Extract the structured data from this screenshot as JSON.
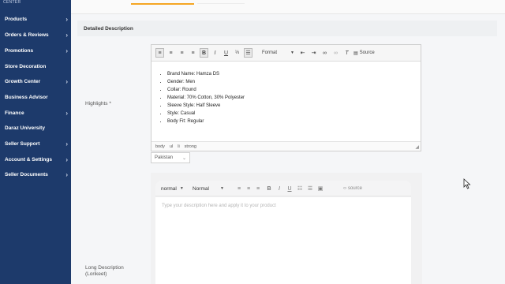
{
  "sidebar": {
    "brand": "CENTER",
    "items": [
      {
        "label": "Products",
        "chevron": true
      },
      {
        "label": "Orders & Reviews",
        "chevron": true
      },
      {
        "label": "Promotions",
        "chevron": true
      },
      {
        "label": "Store Decoration",
        "chevron": false
      },
      {
        "label": "Growth Center",
        "chevron": true
      },
      {
        "label": "Business Advisor",
        "chevron": false
      },
      {
        "label": "Finance",
        "chevron": true
      },
      {
        "label": "Daraz University",
        "chevron": false
      },
      {
        "label": "Seller Support",
        "chevron": true
      },
      {
        "label": "Account & Settings",
        "chevron": true
      },
      {
        "label": "Seller Documents",
        "chevron": true
      }
    ]
  },
  "section": {
    "title": "Detailed Description"
  },
  "highlights": {
    "label": "Highlights *",
    "toolbar": {
      "format_label": "Format",
      "source_label": "Source"
    },
    "bullets": [
      "Brand Name: Hamza DS",
      "Gender: Men",
      "Collar: Round",
      "Material: 70% Cotton, 30% Polyester",
      "Sleeve Style: Half Sleeve",
      "Style: Casual",
      "Body Fit: Regular"
    ],
    "path": [
      "body",
      "ul",
      "li",
      "strong"
    ],
    "country": "Pakistan"
  },
  "long_description": {
    "label": "Long Description (Lorikeet)",
    "toolbar": {
      "style_label": "normal",
      "size_label": "Normal",
      "source_label": "source"
    },
    "placeholder": "Type your description here and apply it to your product"
  }
}
